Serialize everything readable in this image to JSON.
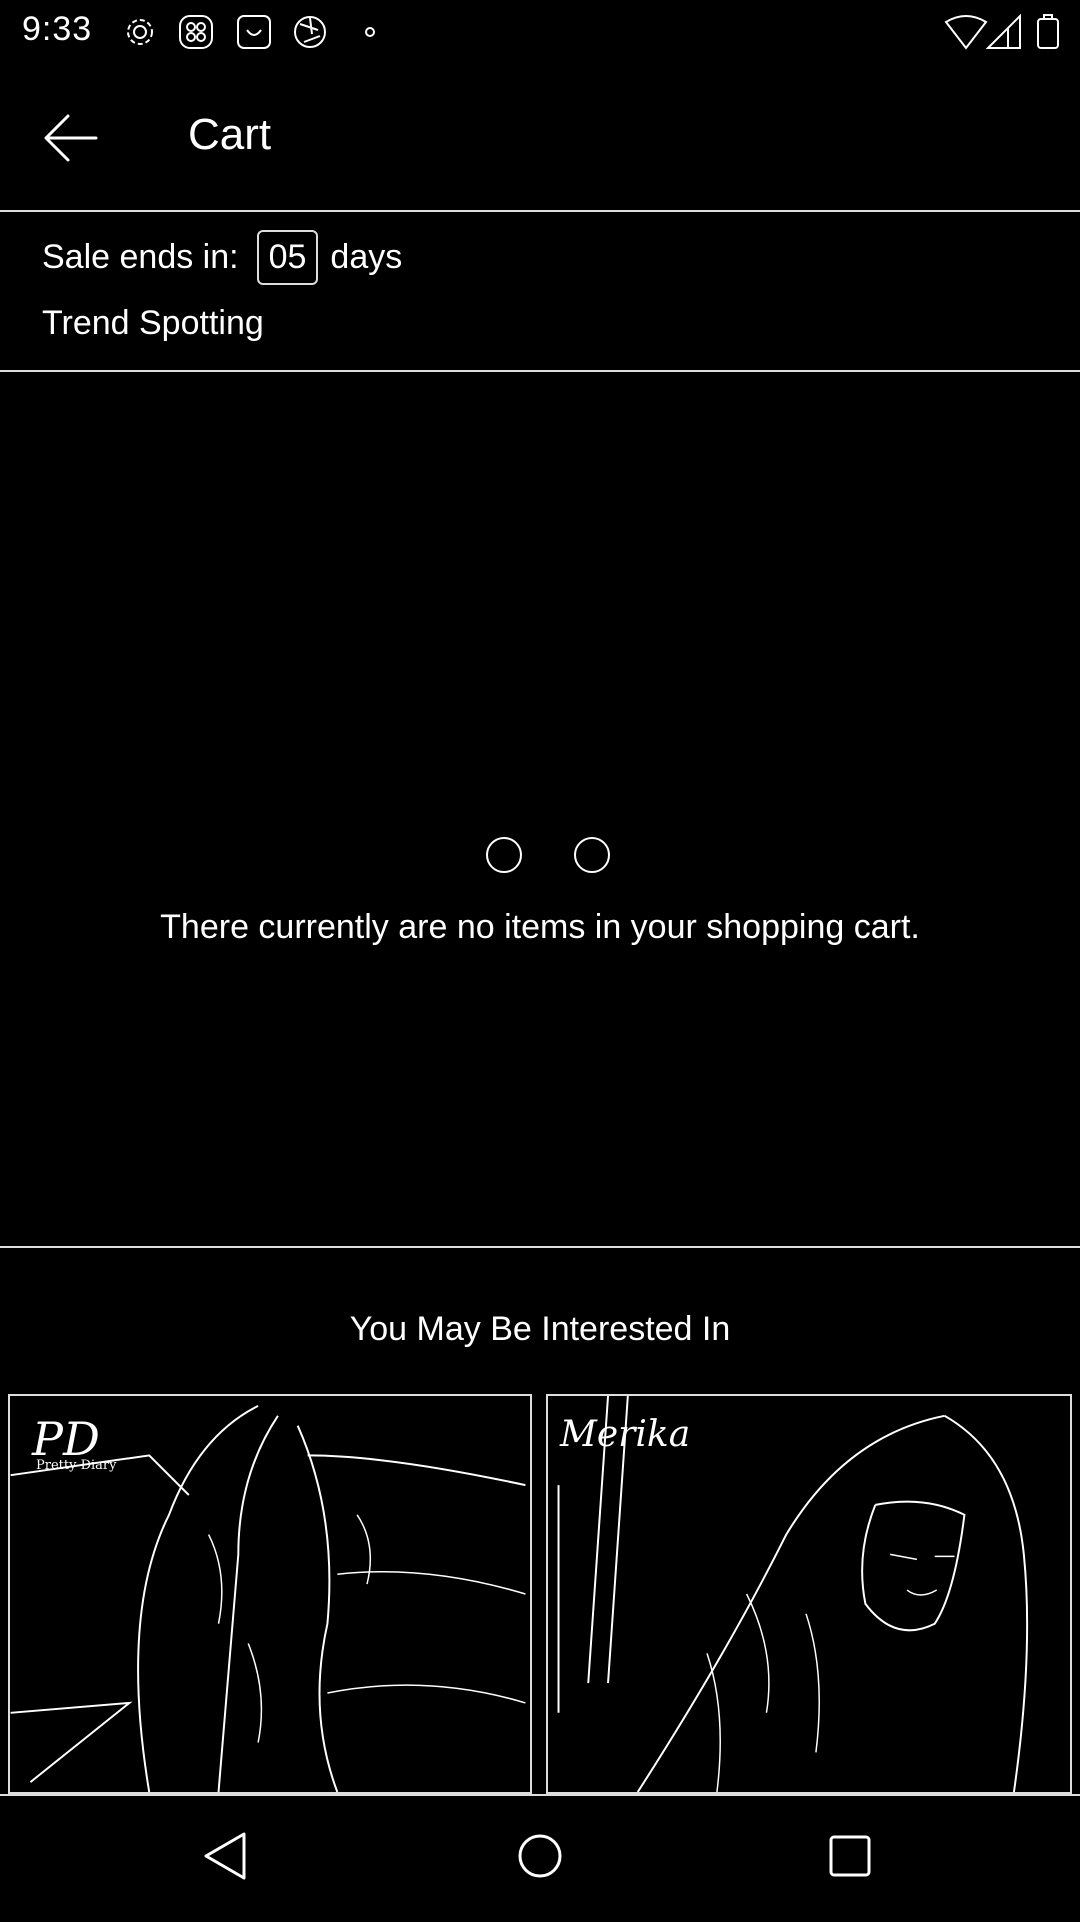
{
  "status_bar": {
    "time": "9:33",
    "left_icons": [
      "gear-icon",
      "app-grid-icon",
      "shopping-bag-icon",
      "aperture-icon",
      "dot-icon"
    ],
    "right_icons": [
      "wifi-icon",
      "cell-signal-icon",
      "battery-icon"
    ]
  },
  "app_bar": {
    "title": "Cart",
    "back_icon": "arrow-left-icon"
  },
  "sale_banner": {
    "label": "Sale ends in:",
    "count": "05",
    "unit": "days",
    "link": "Trend Spotting"
  },
  "empty_cart": {
    "message": "There currently are no items in your shopping cart."
  },
  "recommendations": {
    "title": "You May Be Interested In",
    "products": [
      {
        "brand": "PD",
        "brand_sub": "Pretty Diary"
      },
      {
        "brand": "Merika"
      }
    ]
  },
  "nav_bar": {
    "icons": [
      "back-triangle-icon",
      "home-circle-icon",
      "recents-square-icon"
    ]
  }
}
